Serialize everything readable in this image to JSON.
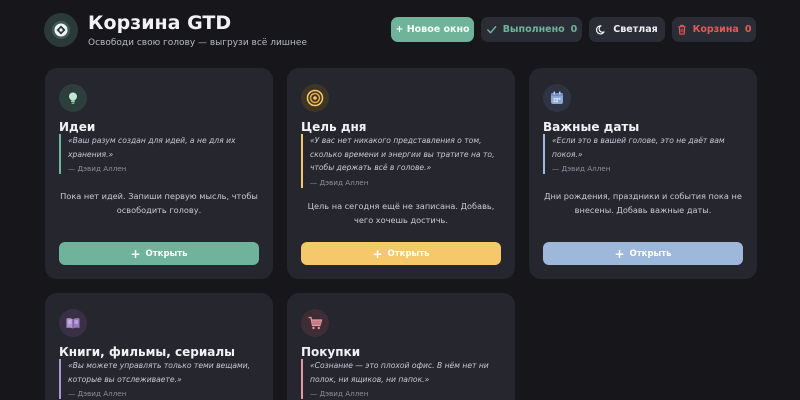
{
  "header": {
    "title": "Корзина GTD",
    "subtitle": "Освободи свою голову — выгрузи всё лишнее",
    "buttons": {
      "new_window": "+ Новое окно",
      "done_label": "Выполнено",
      "done_count": "0",
      "light_label": "Светлая",
      "trash_label": "Корзина",
      "trash_count": "0"
    }
  },
  "colors": {
    "accent": "#6fb49a",
    "danger": "#e35a58",
    "ideas": "#6fb49a",
    "goal": "#f5c96b",
    "dates": "#9eb8dc",
    "books": "#b192d6",
    "shopping": "#e39aa5"
  },
  "cards": [
    {
      "icon": "lightbulb-icon",
      "title": "Идеи",
      "quote": "«Ваш разум создан для идей, а не для их хранения.»",
      "author": "— Дэвид Аллен",
      "empty": "Пока нет идей. Запиши первую мысль, чтобы освободить голову.",
      "open": "Открыть"
    },
    {
      "icon": "target-icon",
      "title": "Цель дня",
      "quote": "«У вас нет никакого представления о том, сколько времени и энергии вы тратите на то, чтобы держать всё в голове.»",
      "author": "— Дэвид Аллен",
      "empty": "Цель на сегодня ещё не записана. Добавь, чего хочешь достичь.",
      "open": "Открыть"
    },
    {
      "icon": "calendar-icon",
      "title": "Важные даты",
      "quote": "«Если это в вашей голове, это не даёт вам покоя.»",
      "author": "— Дэвид Аллен",
      "empty": "Дни рождения, праздники и события пока не внесены. Добавь важные даты.",
      "open": "Открыть"
    },
    {
      "icon": "book-icon",
      "title": "Книги, фильмы, сериалы",
      "quote": "«Вы можете управлять только теми вещами, которые вы отслеживаете.»",
      "author": "— Дэвид Аллен"
    },
    {
      "icon": "shopping-cart-icon",
      "title": "Покупки",
      "quote": "«Сознание — это плохой офис. В нём нет ни полок, ни ящиков, ни папок.»",
      "author": "— Дэвид Аллен"
    }
  ]
}
